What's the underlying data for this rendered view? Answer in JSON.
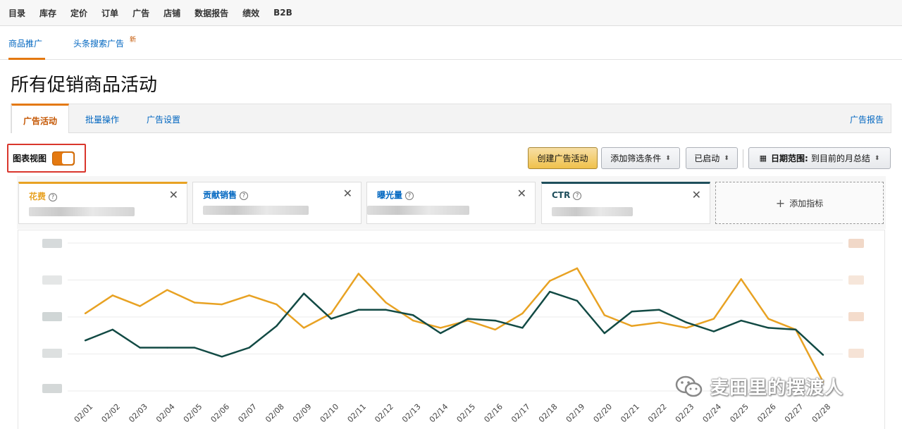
{
  "topnav": [
    "目录",
    "库存",
    "定价",
    "订单",
    "广告",
    "店铺",
    "数据报告",
    "绩效",
    "B2B"
  ],
  "subnav": {
    "items": [
      "商品推广",
      "头条搜索广告"
    ],
    "new_badge": "新"
  },
  "page_title": "所有促销商品活动",
  "tabs": {
    "items": [
      "广告活动",
      "批量操作",
      "广告设置"
    ],
    "report": "广告报告"
  },
  "toolbar": {
    "chart_view_label": "图表视图",
    "create_label": "创建广告活动",
    "add_filter_label": "添加筛选条件",
    "status_label": "已启动",
    "date_range_label": "日期范围:",
    "date_range_value": "到目前的月总结"
  },
  "metrics": [
    {
      "name": "花费",
      "color": "#e8a223"
    },
    {
      "name": "贡献销售",
      "color": "#0066c0"
    },
    {
      "name": "曝光量",
      "color": "#0066c0"
    },
    {
      "name": "CTR",
      "color": "#1f4f5c"
    }
  ],
  "add_metric_label": "添加指标",
  "watermark": "麦田里的摆渡人",
  "colors": {
    "accent": "#e47911",
    "series_spend": "#e8a223",
    "series_ctr": "#124a44"
  },
  "chart_data": {
    "type": "line",
    "categories": [
      "02/01",
      "02/02",
      "02/03",
      "02/04",
      "02/05",
      "02/06",
      "02/07",
      "02/08",
      "02/09",
      "02/10",
      "02/11",
      "02/12",
      "02/13",
      "02/14",
      "02/15",
      "02/16",
      "02/17",
      "02/18",
      "02/19",
      "02/20",
      "02/21",
      "02/22",
      "02/23",
      "02/24",
      "02/25",
      "02/26",
      "02/27",
      "02/28"
    ],
    "series": [
      {
        "name": "花费",
        "color": "#e8a223",
        "values": [
          0.43,
          0.53,
          0.47,
          0.56,
          0.49,
          0.48,
          0.53,
          0.48,
          0.35,
          0.43,
          0.65,
          0.49,
          0.39,
          0.35,
          0.39,
          0.34,
          0.43,
          0.61,
          0.68,
          0.42,
          0.36,
          0.38,
          0.35,
          0.4,
          0.62,
          0.4,
          0.34,
          0.05
        ]
      },
      {
        "name": "CTR",
        "color": "#124a44",
        "values": [
          0.28,
          0.34,
          0.24,
          0.24,
          0.24,
          0.19,
          0.24,
          0.36,
          0.54,
          0.4,
          0.45,
          0.45,
          0.42,
          0.32,
          0.4,
          0.39,
          0.35,
          0.55,
          0.5,
          0.32,
          0.44,
          0.45,
          0.38,
          0.33,
          0.39,
          0.35,
          0.34,
          0.2
        ]
      }
    ],
    "ylim": [
      0,
      0.82
    ],
    "grid": true,
    "legend": "none"
  }
}
